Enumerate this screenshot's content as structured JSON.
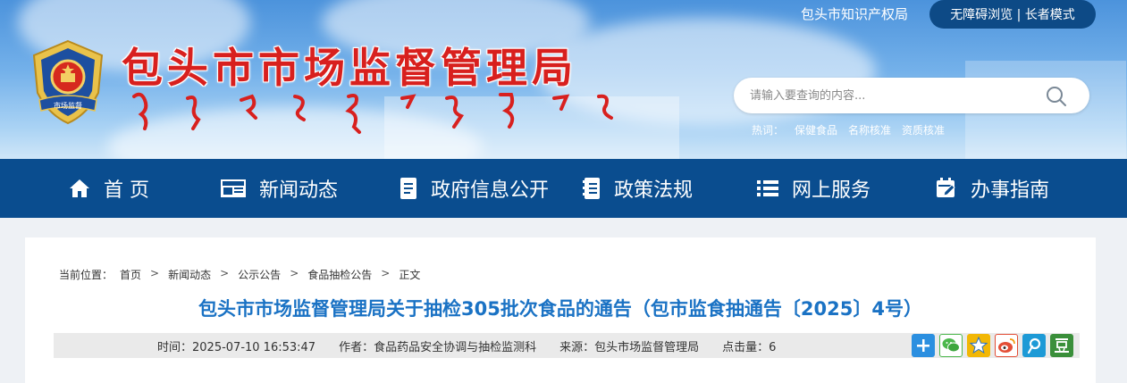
{
  "header": {
    "site_title": "包头市市场监督管理局",
    "top_link": "包头市知识产权局",
    "accessibility": "无障碍浏览 | 长者模式",
    "search": {
      "placeholder": "请输入要查询的内容..."
    },
    "hot": {
      "label": "热词：",
      "words": [
        "保健食品",
        "名称核准",
        "资质核准"
      ]
    }
  },
  "nav": {
    "items": [
      {
        "label": "首 页",
        "icon": "home-icon"
      },
      {
        "label": "新闻动态",
        "icon": "news-icon"
      },
      {
        "label": "政府信息公开",
        "icon": "document-icon"
      },
      {
        "label": "政策法规",
        "icon": "book-icon"
      },
      {
        "label": "网上服务",
        "icon": "list-icon"
      },
      {
        "label": "办事指南",
        "icon": "calendar-edit-icon"
      }
    ]
  },
  "breadcrumb": {
    "label": "当前位置：",
    "items": [
      "首页",
      "新闻动态",
      "公示公告",
      "食品抽检公告",
      "正文"
    ],
    "separator": ">"
  },
  "article": {
    "title": "包头市市场监督管理局关于抽检305批次食品的通告（包市监食抽通告〔2025〕4号）",
    "time": "时间：2025-07-10 16:53:47",
    "author": "作者：食品药品安全协调与抽检监测科",
    "source": "来源：包头市场监督管理局",
    "clicks": "点击量：6"
  },
  "share_icons": [
    "plus-share-icon",
    "wechat-icon",
    "qzone-icon",
    "weibo-icon",
    "tencent-weibo-icon",
    "douban-icon"
  ],
  "colors": {
    "nav_bg": "#0a4d8f",
    "title_red": "#d8201e",
    "article_title_blue": "#1a72c4"
  }
}
